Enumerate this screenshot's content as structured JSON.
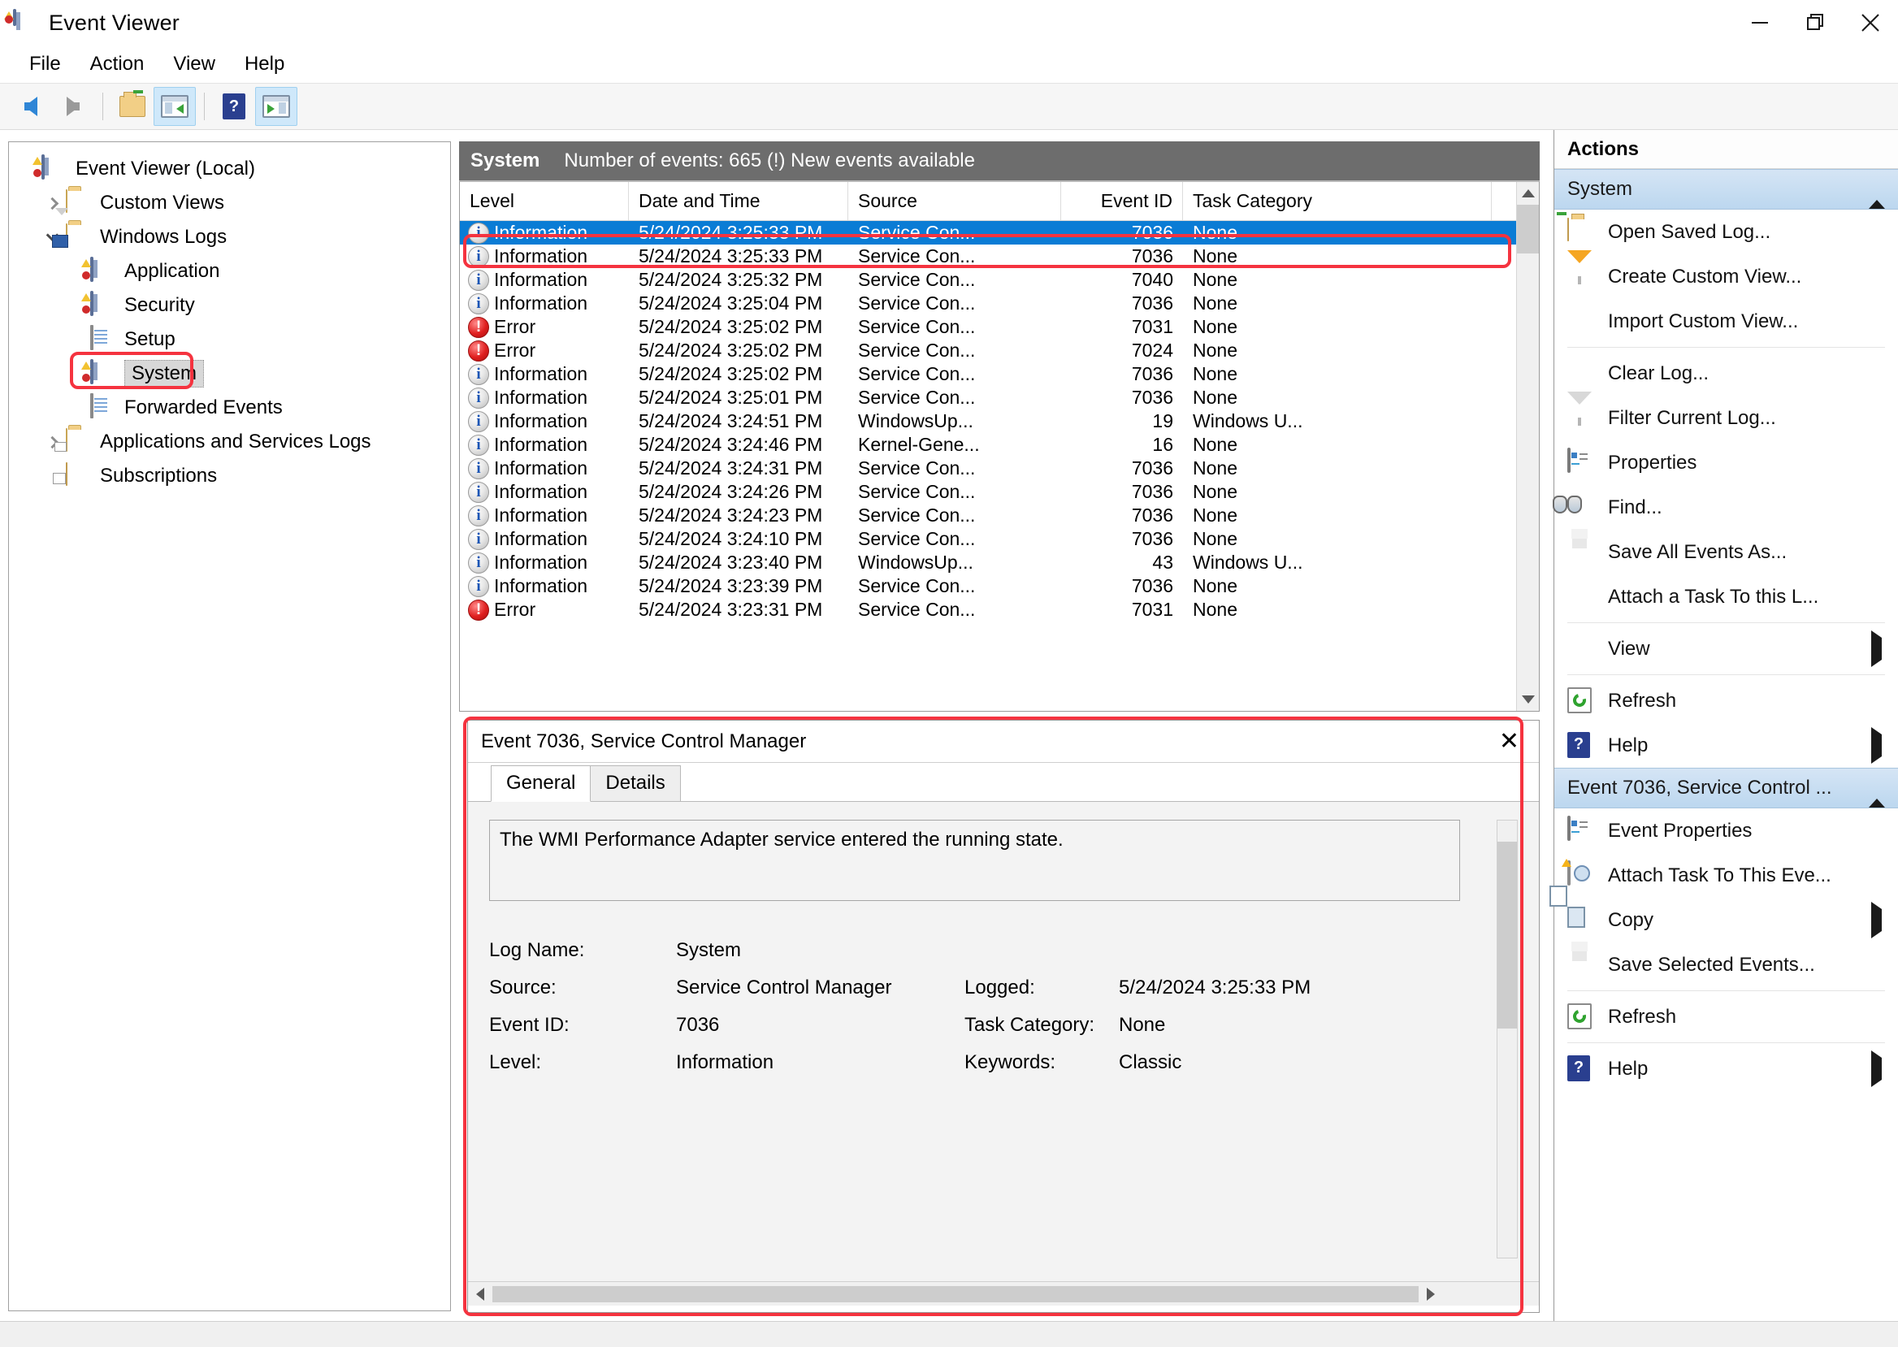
{
  "window": {
    "title": "Event Viewer",
    "app_icon": "event-viewer-icon",
    "controls": {
      "minimize": "minimize-icon",
      "maximize": "restore-icon",
      "close": "close-icon"
    }
  },
  "menubar": {
    "items": [
      "File",
      "Action",
      "View",
      "Help"
    ]
  },
  "toolbar": {
    "buttons": [
      {
        "name": "back-button",
        "icon": "back-arrow-icon",
        "selected": false
      },
      {
        "name": "forward-button",
        "icon": "forward-arrow-icon",
        "selected": false
      },
      {
        "name": "up-one-level-button",
        "icon": "folder-up-icon",
        "selected": false
      },
      {
        "name": "show-hide-console-tree-button",
        "icon": "console-tree-icon",
        "selected": true
      },
      {
        "name": "help-button",
        "icon": "help-icon",
        "selected": false
      },
      {
        "name": "show-hide-action-pane-button",
        "icon": "action-pane-icon",
        "selected": true
      }
    ]
  },
  "tree": {
    "nodes": [
      {
        "label": "Event Viewer (Local)",
        "icon": "event-viewer-icon",
        "indent": 0,
        "expander": "none",
        "selected": false
      },
      {
        "label": "Custom Views",
        "icon": "custom-views-folder-icon",
        "indent": 1,
        "expander": "collapsed",
        "selected": false
      },
      {
        "label": "Windows Logs",
        "icon": "windows-logs-folder-icon",
        "indent": 1,
        "expander": "expanded",
        "selected": false
      },
      {
        "label": "Application",
        "icon": "log-icon",
        "indent": 2,
        "expander": "none",
        "selected": false
      },
      {
        "label": "Security",
        "icon": "log-icon",
        "indent": 2,
        "expander": "none",
        "selected": false
      },
      {
        "label": "Setup",
        "icon": "log-plain-icon",
        "indent": 2,
        "expander": "none",
        "selected": false
      },
      {
        "label": "System",
        "icon": "log-icon",
        "indent": 2,
        "expander": "none",
        "selected": true
      },
      {
        "label": "Forwarded Events",
        "icon": "log-plain-icon",
        "indent": 2,
        "expander": "none",
        "selected": false
      },
      {
        "label": "Applications and Services Logs",
        "icon": "app-services-folder-icon",
        "indent": 1,
        "expander": "collapsed",
        "selected": false
      },
      {
        "label": "Subscriptions",
        "icon": "subscriptions-icon",
        "indent": 1,
        "expander": "none",
        "selected": false
      }
    ]
  },
  "events_list": {
    "header": {
      "log_name": "System",
      "status": "Number of events: 665 (!) New events available"
    },
    "columns": [
      "Level",
      "Date and Time",
      "Source",
      "Event ID",
      "Task Category"
    ],
    "rows": [
      {
        "level": "Information",
        "icon": "information-icon",
        "date": "5/24/2024 3:25:33 PM",
        "source": "Service Con...",
        "event_id": "7036",
        "task": "None",
        "selected": true
      },
      {
        "level": "Information",
        "icon": "information-icon",
        "date": "5/24/2024 3:25:33 PM",
        "source": "Service Con...",
        "event_id": "7036",
        "task": "None",
        "selected": false
      },
      {
        "level": "Information",
        "icon": "information-icon",
        "date": "5/24/2024 3:25:32 PM",
        "source": "Service Con...",
        "event_id": "7040",
        "task": "None",
        "selected": false
      },
      {
        "level": "Information",
        "icon": "information-icon",
        "date": "5/24/2024 3:25:04 PM",
        "source": "Service Con...",
        "event_id": "7036",
        "task": "None",
        "selected": false
      },
      {
        "level": "Error",
        "icon": "error-icon",
        "date": "5/24/2024 3:25:02 PM",
        "source": "Service Con...",
        "event_id": "7031",
        "task": "None",
        "selected": false
      },
      {
        "level": "Error",
        "icon": "error-icon",
        "date": "5/24/2024 3:25:02 PM",
        "source": "Service Con...",
        "event_id": "7024",
        "task": "None",
        "selected": false
      },
      {
        "level": "Information",
        "icon": "information-icon",
        "date": "5/24/2024 3:25:02 PM",
        "source": "Service Con...",
        "event_id": "7036",
        "task": "None",
        "selected": false
      },
      {
        "level": "Information",
        "icon": "information-icon",
        "date": "5/24/2024 3:25:01 PM",
        "source": "Service Con...",
        "event_id": "7036",
        "task": "None",
        "selected": false
      },
      {
        "level": "Information",
        "icon": "information-icon",
        "date": "5/24/2024 3:24:51 PM",
        "source": "WindowsUp...",
        "event_id": "19",
        "task": "Windows U...",
        "selected": false
      },
      {
        "level": "Information",
        "icon": "information-icon",
        "date": "5/24/2024 3:24:46 PM",
        "source": "Kernel-Gene...",
        "event_id": "16",
        "task": "None",
        "selected": false
      },
      {
        "level": "Information",
        "icon": "information-icon",
        "date": "5/24/2024 3:24:31 PM",
        "source": "Service Con...",
        "event_id": "7036",
        "task": "None",
        "selected": false
      },
      {
        "level": "Information",
        "icon": "information-icon",
        "date": "5/24/2024 3:24:26 PM",
        "source": "Service Con...",
        "event_id": "7036",
        "task": "None",
        "selected": false
      },
      {
        "level": "Information",
        "icon": "information-icon",
        "date": "5/24/2024 3:24:23 PM",
        "source": "Service Con...",
        "event_id": "7036",
        "task": "None",
        "selected": false
      },
      {
        "level": "Information",
        "icon": "information-icon",
        "date": "5/24/2024 3:24:10 PM",
        "source": "Service Con...",
        "event_id": "7036",
        "task": "None",
        "selected": false
      },
      {
        "level": "Information",
        "icon": "information-icon",
        "date": "5/24/2024 3:23:40 PM",
        "source": "WindowsUp...",
        "event_id": "43",
        "task": "Windows U...",
        "selected": false
      },
      {
        "level": "Information",
        "icon": "information-icon",
        "date": "5/24/2024 3:23:39 PM",
        "source": "Service Con...",
        "event_id": "7036",
        "task": "None",
        "selected": false
      },
      {
        "level": "Error",
        "icon": "error-icon",
        "date": "5/24/2024 3:23:31 PM",
        "source": "Service Con...",
        "event_id": "7031",
        "task": "None",
        "selected": false
      }
    ]
  },
  "detail_pane": {
    "title": "Event 7036, Service Control Manager",
    "close_label": "✕",
    "tabs": [
      {
        "label": "General",
        "active": true
      },
      {
        "label": "Details",
        "active": false
      }
    ],
    "message": "The WMI Performance Adapter service entered the running state.",
    "fields": [
      {
        "label": "Log Name:",
        "value": "System",
        "label2": "",
        "value2": ""
      },
      {
        "label": "Source:",
        "value": "Service Control Manager",
        "label2": "Logged:",
        "value2": "5/24/2024 3:25:33 PM"
      },
      {
        "label": "Event ID:",
        "value": "7036",
        "label2": "Task Category:",
        "value2": "None"
      },
      {
        "label": "Level:",
        "value": "Information",
        "label2": "Keywords:",
        "value2": "Classic"
      }
    ]
  },
  "actions": {
    "title": "Actions",
    "groups": [
      {
        "name": "System",
        "expander": "expanded",
        "items": [
          {
            "label": "Open Saved Log...",
            "icon": "open-saved-log-icon",
            "submenu": false,
            "divider_after": false
          },
          {
            "label": "Create Custom View...",
            "icon": "create-custom-view-icon",
            "submenu": false,
            "divider_after": false
          },
          {
            "label": "Import Custom View...",
            "icon": "none",
            "submenu": false,
            "divider_after": true
          },
          {
            "label": "Clear Log...",
            "icon": "none",
            "submenu": false,
            "divider_after": false
          },
          {
            "label": "Filter Current Log...",
            "icon": "filter-icon",
            "submenu": false,
            "divider_after": false
          },
          {
            "label": "Properties",
            "icon": "properties-icon",
            "submenu": false,
            "divider_after": false
          },
          {
            "label": "Find...",
            "icon": "find-icon",
            "submenu": false,
            "divider_after": false
          },
          {
            "label": "Save All Events As...",
            "icon": "save-icon",
            "submenu": false,
            "divider_after": false
          },
          {
            "label": "Attach a Task To this L...",
            "icon": "none",
            "submenu": false,
            "divider_after": true
          },
          {
            "label": "View",
            "icon": "none",
            "submenu": true,
            "divider_after": true
          },
          {
            "label": "Refresh",
            "icon": "refresh-icon",
            "submenu": false,
            "divider_after": false
          },
          {
            "label": "Help",
            "icon": "help-icon",
            "submenu": true,
            "divider_after": false
          }
        ]
      },
      {
        "name": "Event 7036, Service Control ...",
        "expander": "expanded",
        "items": [
          {
            "label": "Event Properties",
            "icon": "properties-icon",
            "submenu": false,
            "divider_after": false
          },
          {
            "label": "Attach Task To This Eve...",
            "icon": "attach-task-icon",
            "submenu": false,
            "divider_after": false
          },
          {
            "label": "Copy",
            "icon": "copy-icon",
            "submenu": true,
            "divider_after": false
          },
          {
            "label": "Save Selected Events...",
            "icon": "save-icon",
            "submenu": false,
            "divider_after": true
          },
          {
            "label": "Refresh",
            "icon": "refresh-icon",
            "submenu": false,
            "divider_after": true
          },
          {
            "label": "Help",
            "icon": "help-icon",
            "submenu": true,
            "divider_after": false
          }
        ]
      }
    ]
  },
  "highlights": {
    "color": "#f5333f",
    "regions": [
      "tree-system-node",
      "selected-event-row",
      "detail-pane"
    ]
  }
}
